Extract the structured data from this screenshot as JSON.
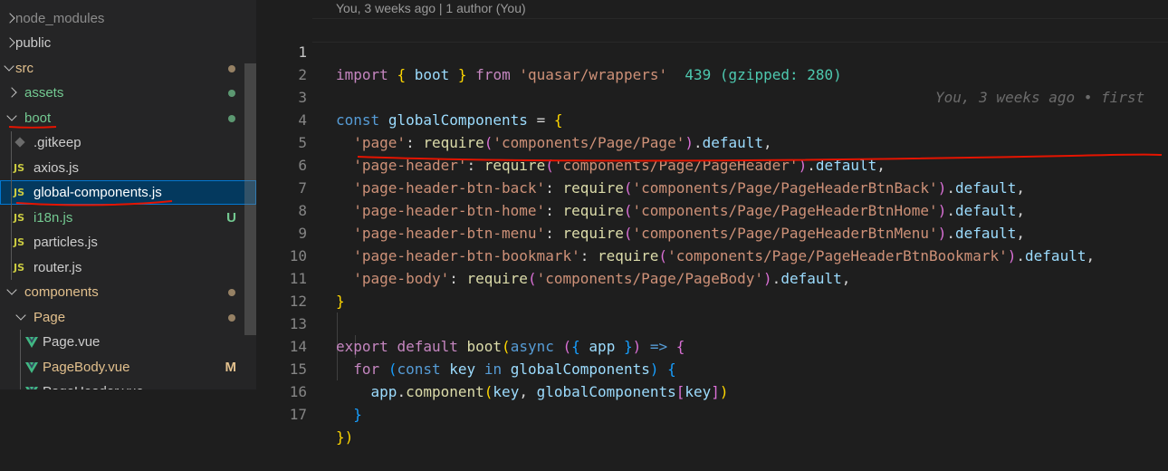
{
  "explorer": {
    "items": [
      {
        "label": "node_modules",
        "type": "folder",
        "expanded": false
      },
      {
        "label": "public",
        "type": "folder",
        "expanded": false
      },
      {
        "label": "src",
        "type": "folder",
        "expanded": true
      },
      {
        "label": "assets",
        "type": "folder",
        "expanded": false
      },
      {
        "label": "boot",
        "type": "folder",
        "expanded": true
      },
      {
        "label": ".gitkeep",
        "type": "file"
      },
      {
        "label": "axios.js",
        "type": "js-file"
      },
      {
        "label": "global-components.js",
        "type": "js-file",
        "selected": true
      },
      {
        "label": "i18n.js",
        "type": "js-file",
        "status": "U"
      },
      {
        "label": "particles.js",
        "type": "js-file"
      },
      {
        "label": "router.js",
        "type": "js-file"
      },
      {
        "label": "components",
        "type": "folder",
        "expanded": true
      },
      {
        "label": "Page",
        "type": "folder",
        "expanded": true
      },
      {
        "label": "Page.vue",
        "type": "vue-file"
      },
      {
        "label": "PageBody.vue",
        "type": "vue-file",
        "status": "M"
      },
      {
        "label": "PageHeader.vue",
        "type": "vue-file"
      }
    ],
    "js_icon_text": "JS",
    "colors": {
      "modified": "#e2c08d",
      "untracked": "#73c991",
      "ignored": "#8c8c8c",
      "vue": "#41b883",
      "js": "#cbcb41"
    }
  },
  "editor": {
    "codelens": "You, 3 weeks ago | 1 author (You)",
    "line1": {
      "import_kw": "import",
      "brace_open": "{",
      "boot": "boot",
      "brace_close": "}",
      "from_kw": "from",
      "module": "'quasar/wrappers'",
      "size": "439 (gzipped: 280)",
      "blame": "You, 3 weeks ago • first"
    },
    "line_numbers": [
      "1",
      "2",
      "3",
      "4",
      "5",
      "6",
      "7",
      "8",
      "9",
      "10",
      "11",
      "12",
      "13",
      "14",
      "15",
      "16",
      "17"
    ],
    "line3": {
      "kw": "const",
      "name": "globalComponents",
      "eq": " = ",
      "brace": "{"
    },
    "component_lines": [
      {
        "key": "'page'",
        "path": "'components/Page/Page'"
      },
      {
        "key": "'page-header'",
        "path": "'components/Page/PageHeader'"
      },
      {
        "key": "'page-header-btn-back'",
        "path": "'components/Page/PageHeaderBtnBack'"
      },
      {
        "key": "'page-header-btn-home'",
        "path": "'components/Page/PageHeaderBtnHome'"
      },
      {
        "key": "'page-header-btn-menu'",
        "path": "'components/Page/PageHeaderBtnMenu'"
      },
      {
        "key": "'page-header-btn-bookmark'",
        "path": "'components/Page/PageHeaderBtnBookmark'"
      },
      {
        "key": "'page-body'",
        "path": "'components/Page/PageBody'"
      }
    ],
    "require_fn": "require",
    "default_prop": "default",
    "line11": "}",
    "line13": {
      "export_kw": "export",
      "default_kw": "default",
      "fn": "boot",
      "async_kw": "async",
      "param": "app"
    },
    "line14": {
      "for_kw": "for",
      "const_kw": "const",
      "key": "key",
      "in_kw": "in",
      "obj": "globalComponents"
    },
    "line15": {
      "obj": "app",
      "method": "component",
      "arg1": "key",
      "arg2": "globalComponents",
      "arg3": "key"
    },
    "line16": "}",
    "line17": "})"
  },
  "theme": {
    "background": "#1e1e1e",
    "sidebar": "#252526",
    "selection": "#04395e",
    "annotation": "#e51400"
  }
}
